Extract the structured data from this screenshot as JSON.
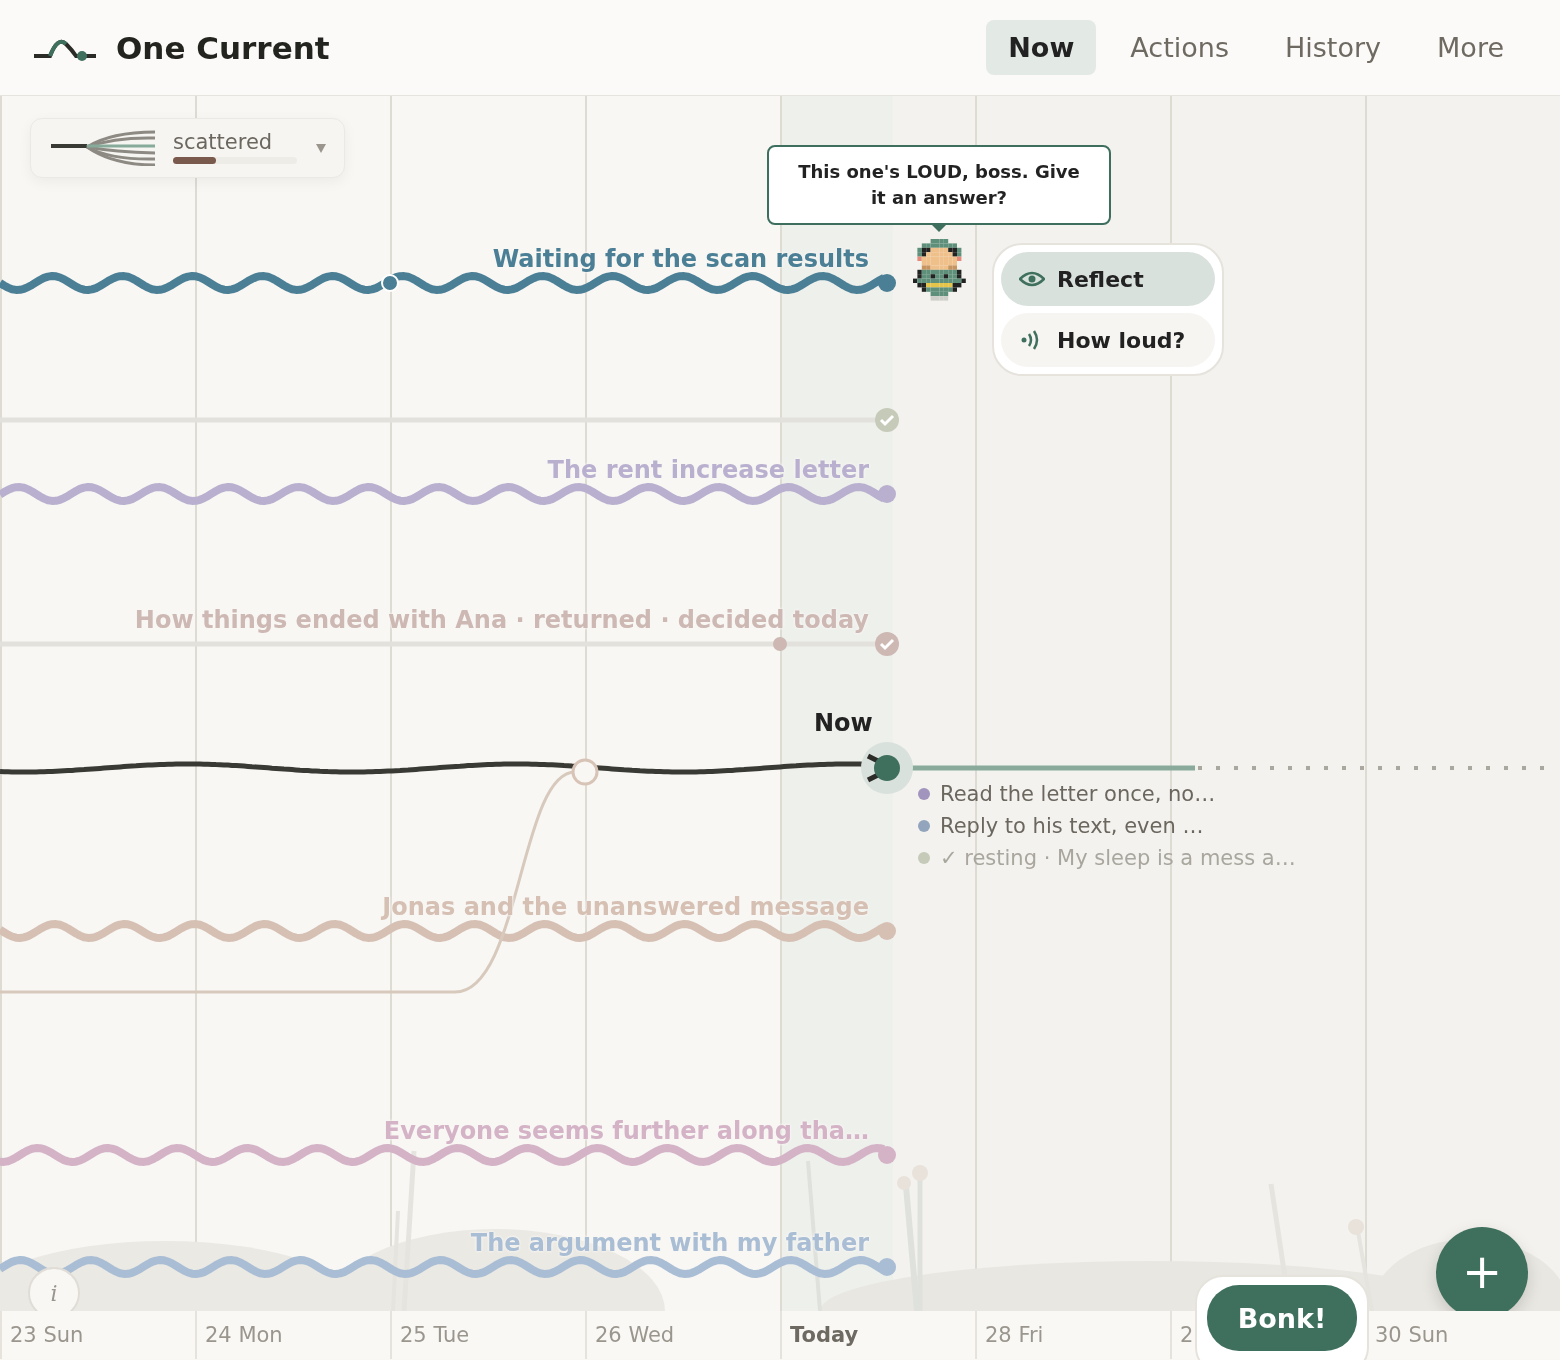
{
  "header": {
    "title": "One Current",
    "tabs": [
      {
        "label": "Now",
        "selected": true
      },
      {
        "label": "Actions",
        "selected": false
      },
      {
        "label": "History",
        "selected": false
      },
      {
        "label": "More",
        "selected": false
      }
    ]
  },
  "mode": {
    "label": "scattered",
    "level": 0.35
  },
  "bubble": {
    "text": "This one's LOUD, boss. Give it an answer?"
  },
  "menu": [
    {
      "label": "Reflect",
      "kind": "eye",
      "selected": true
    },
    {
      "label": "How loud?",
      "kind": "sound",
      "selected": false
    }
  ],
  "threads": [
    {
      "label": "Waiting for the scan results",
      "color": "#4b7f95",
      "kind": "wave",
      "resolved": false
    },
    {
      "color": "#c5cbb8",
      "kind": "flat",
      "resolved": true
    },
    {
      "label": "The rent increase letter",
      "color": "#b9b0cf",
      "kind": "wave",
      "resolved": false
    },
    {
      "label": "How things ended with Ana · returned · decided today",
      "color": "#cdb8b3",
      "kind": "flat",
      "resolved": true
    },
    {
      "label": "Jonas and the unanswered message",
      "color": "#d6c0b3",
      "kind": "wave",
      "resolved": false
    },
    {
      "label": "Everyone seems further along tha…",
      "color": "#d4b3c7",
      "kind": "wave",
      "resolved": false
    },
    {
      "label": "The argument with my father",
      "color": "#a9bdd4",
      "kind": "wave",
      "resolved": false
    }
  ],
  "now": {
    "label": "Now",
    "tasks": [
      {
        "text": "Read the letter once, no…",
        "color": "#a195bd",
        "muted": false
      },
      {
        "text": "Reply to his text, even …",
        "color": "#93a5bd",
        "muted": false
      },
      {
        "text": "✓ resting · My sleep is a mess a…",
        "color": "#c5cbb8",
        "muted": true
      }
    ]
  },
  "days": [
    {
      "label": "23 Sun",
      "selected": false
    },
    {
      "label": "24 Mon",
      "selected": false
    },
    {
      "label": "25 Tue",
      "selected": false
    },
    {
      "label": "26 Wed",
      "selected": false
    },
    {
      "label": "Today",
      "selected": true
    },
    {
      "label": "28 Fri",
      "selected": false
    },
    {
      "label": "2",
      "selected": false
    },
    {
      "label": "30 Sun",
      "selected": false
    }
  ],
  "info_button": "i",
  "bonk_button": "Bonk!",
  "add_button": "+"
}
